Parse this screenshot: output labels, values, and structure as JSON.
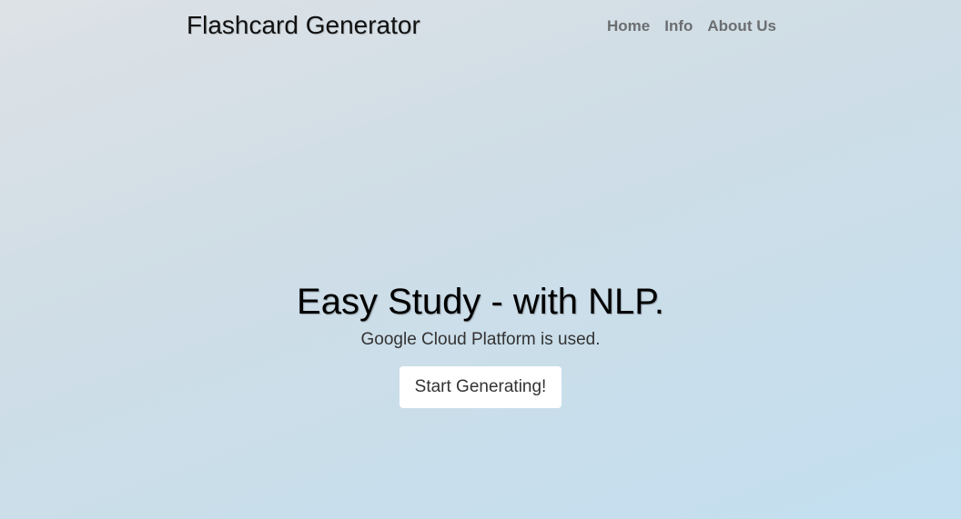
{
  "nav": {
    "brand": "Flashcard Generator",
    "links": [
      "Home",
      "Info",
      "About Us"
    ]
  },
  "hero": {
    "title": "Easy Study - with NLP.",
    "subtitle": "Google Cloud Platform is used.",
    "cta": "Start Generating!"
  }
}
